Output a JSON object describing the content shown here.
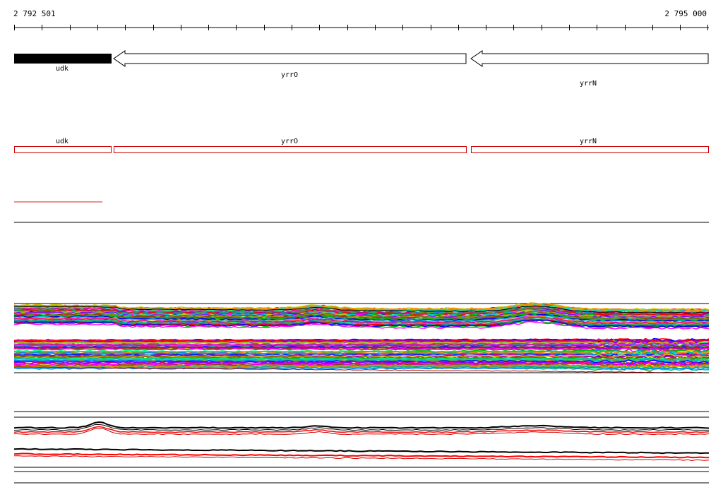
{
  "ruler": {
    "start_label": "2 792 501",
    "end_label": "2 795 000"
  },
  "genes": [
    {
      "name": "udk",
      "strand": "+",
      "selected": true
    },
    {
      "name": "yrrO",
      "strand": "-",
      "selected": false
    },
    {
      "name": "yrrN",
      "strand": "-",
      "selected": false
    }
  ],
  "colors": {
    "gene_fill_selected": "#000000",
    "gene_outline": "#000000",
    "annotation_box": "#cc0000",
    "track_red": "#ff0000",
    "track_black": "#000000"
  }
}
